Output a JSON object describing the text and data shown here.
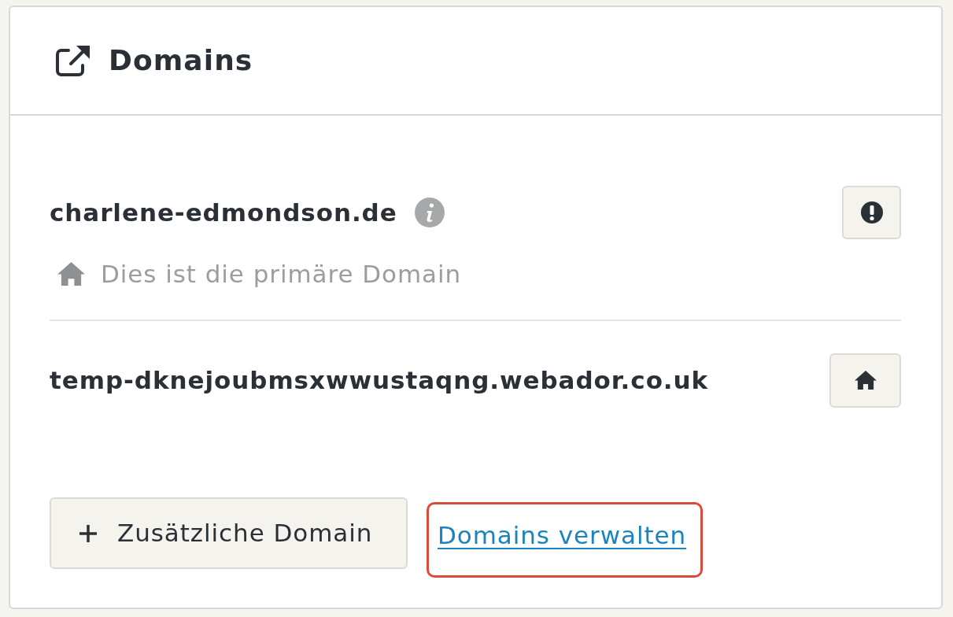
{
  "panel": {
    "title": "Domains"
  },
  "domains": [
    {
      "name": "charlene-edmondson.de",
      "info": true,
      "primary": true,
      "note": "Dies ist die primäre Domain",
      "kind": "alert"
    },
    {
      "name": "temp-dknejoubmsxwwustaqng.webador.co.uk",
      "info": false,
      "primary": false,
      "kind": "home"
    }
  ],
  "add_button": {
    "label": "Zusätzliche Domain"
  },
  "manage_link": {
    "label": "Domains verwalten",
    "highlighted": true
  }
}
